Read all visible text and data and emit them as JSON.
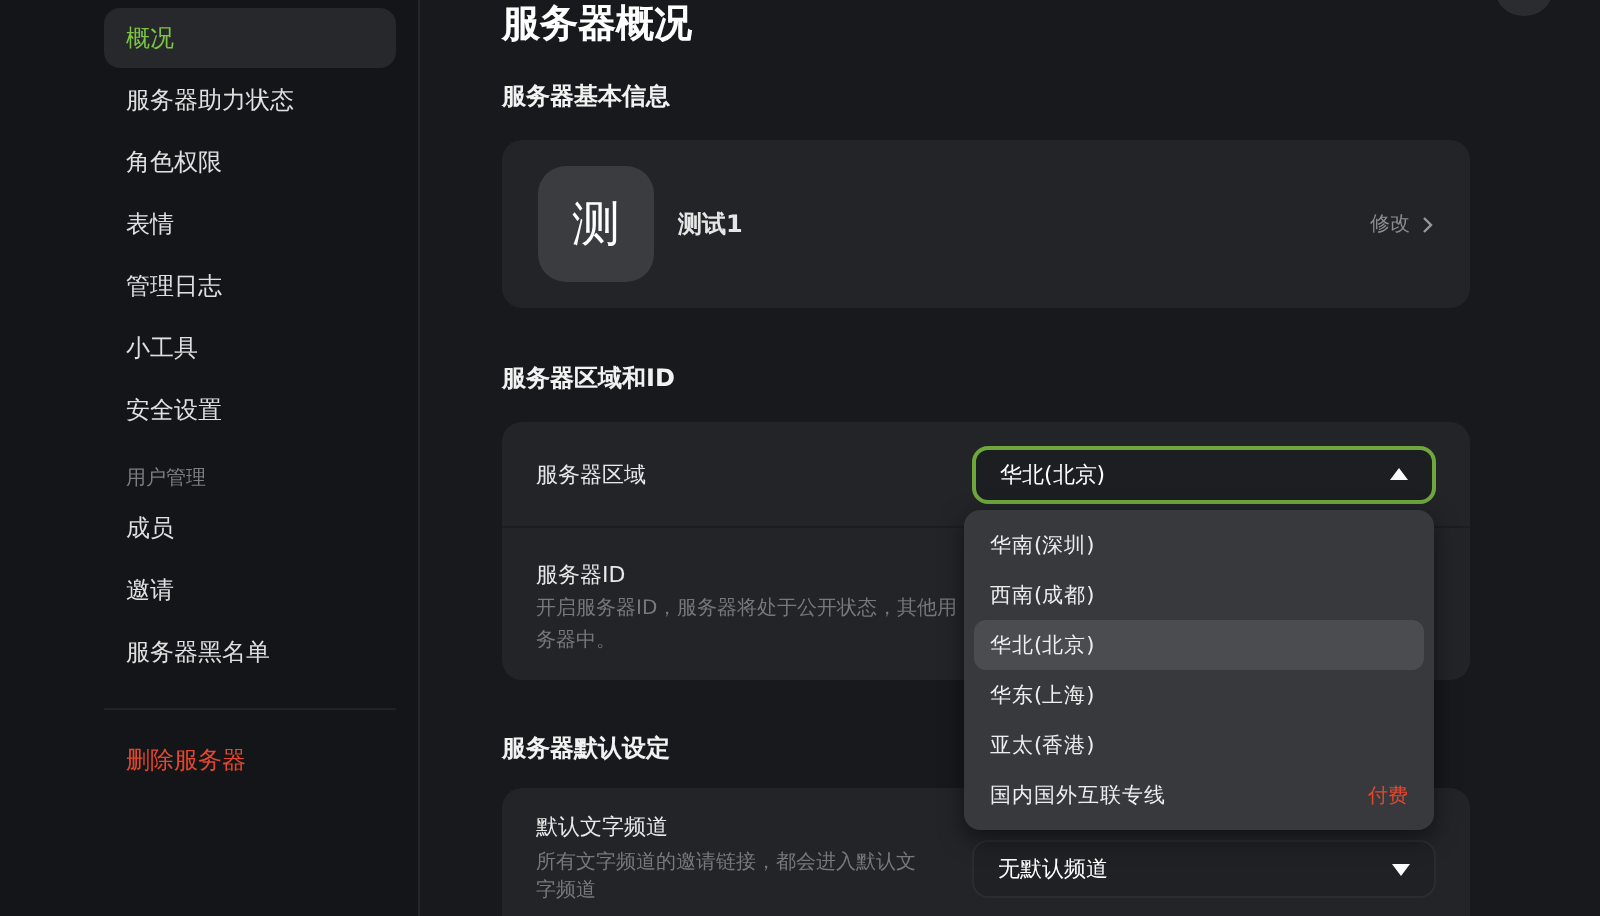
{
  "sidebar": {
    "items": [
      {
        "label": "概况",
        "selected": true,
        "kind": "item"
      },
      {
        "label": "服务器助力状态",
        "selected": false,
        "kind": "item"
      },
      {
        "label": "角色权限",
        "selected": false,
        "kind": "item"
      },
      {
        "label": "表情",
        "selected": false,
        "kind": "item"
      },
      {
        "label": "管理日志",
        "selected": false,
        "kind": "item"
      },
      {
        "label": "小工具",
        "selected": false,
        "kind": "item"
      },
      {
        "label": "安全设置",
        "selected": false,
        "kind": "item"
      },
      {
        "label": "用户管理",
        "kind": "header"
      },
      {
        "label": "成员",
        "selected": false,
        "kind": "item"
      },
      {
        "label": "邀请",
        "selected": false,
        "kind": "item"
      },
      {
        "label": "服务器黑名单",
        "selected": false,
        "kind": "item"
      },
      {
        "label": "删除服务器",
        "selected": false,
        "kind": "danger"
      }
    ]
  },
  "page": {
    "title": "服务器概况",
    "basic_info": {
      "heading": "服务器基本信息",
      "avatar_letter": "测",
      "name": "测试1",
      "edit_label": "修改"
    },
    "region": {
      "heading": "服务器区域和ID",
      "region_label": "服务器区域",
      "region_value": "华北(北京)",
      "dropdown_open": true,
      "id_label": "服务器ID",
      "id_description_lines": [
        "开启服务器ID，服务器将处于公开状态，其他用",
        "务器中。"
      ],
      "options": [
        {
          "label": "华南(深圳)",
          "selected": false
        },
        {
          "label": "西南(成都)",
          "selected": false
        },
        {
          "label": "华北(北京)",
          "selected": true
        },
        {
          "label": "华东(上海)",
          "selected": false
        },
        {
          "label": "亚太(香港)",
          "selected": false
        },
        {
          "label": "国内国外互联专线",
          "selected": false,
          "tag": "付费"
        }
      ]
    },
    "defaults": {
      "heading": "服务器默认设定",
      "channel_label": "默认文字频道",
      "channel_description": "所有文字频道的邀请链接，都会进入默认文字频道",
      "channel_value": "无默认频道"
    }
  }
}
